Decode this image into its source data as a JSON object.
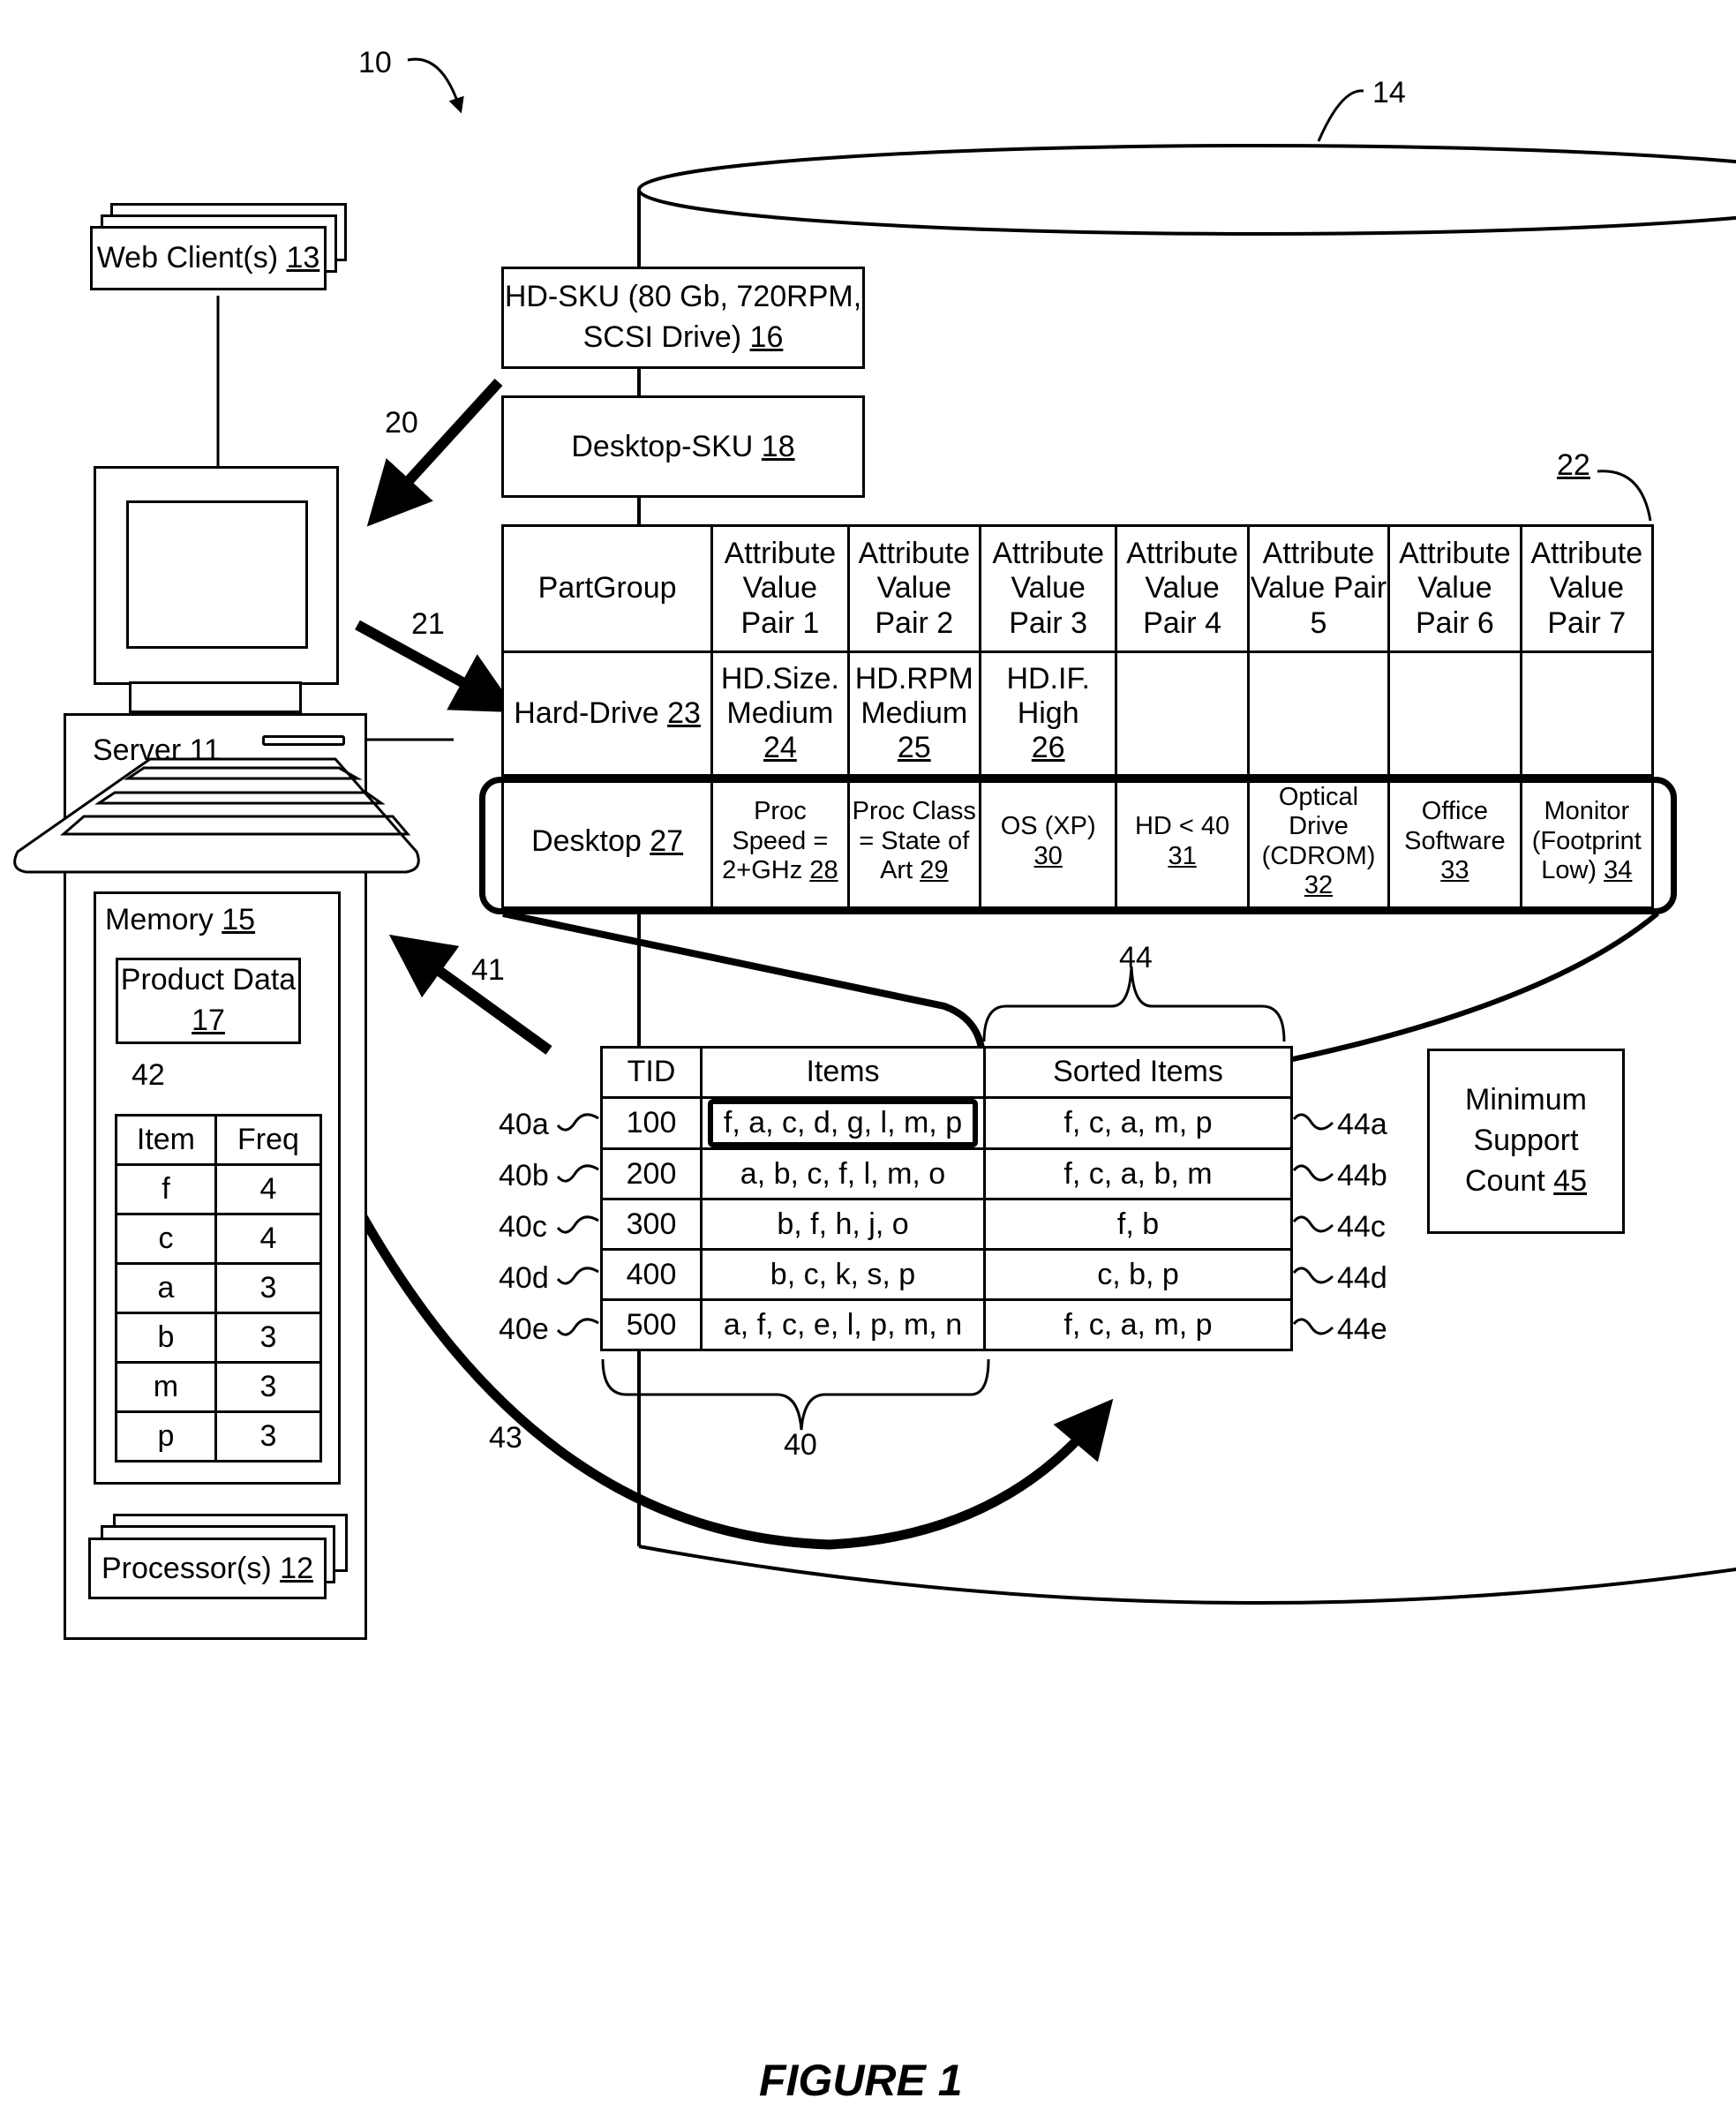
{
  "figure": {
    "caption": "FIGURE 1",
    "system_ref": "10",
    "database_ref": "14"
  },
  "web_clients": {
    "label": "Web Client(s)",
    "ref": "13"
  },
  "server": {
    "label": "Server",
    "ref": "11"
  },
  "memory": {
    "label": "Memory",
    "ref": "15"
  },
  "product_data": {
    "label": "Product Data",
    "ref": "17"
  },
  "processors": {
    "label": "Processor(s)",
    "ref": "12"
  },
  "hd_sku": {
    "line1": "HD-SKU (80 Gb, 720RPM,",
    "line2": "SCSI Drive)",
    "ref": "16"
  },
  "desktop_sku": {
    "label": "Desktop-SKU",
    "ref": "18"
  },
  "arrows": {
    "a20": "20",
    "a21": "21",
    "a41": "41",
    "a43": "43"
  },
  "attribute_table": {
    "ref": "22",
    "header": {
      "partgroup": "PartGroup",
      "pairs": [
        "Attribute Value Pair 1",
        "Attribute Value Pair 2",
        "Attribute Value Pair 3",
        "Attribute Value Pair 4",
        "Attribute Value Pair 5",
        "Attribute Value Pair 6",
        "Attribute Value Pair 7"
      ]
    },
    "rows": [
      {
        "group": "Hard-Drive",
        "group_ref": "23",
        "cells": [
          {
            "text": "HD.Size. Medium",
            "ref": "24"
          },
          {
            "text": "HD.RPM Medium",
            "ref": "25"
          },
          {
            "text": "HD.IF. High",
            "ref": "26"
          },
          {
            "text": "",
            "ref": ""
          },
          {
            "text": "",
            "ref": ""
          },
          {
            "text": "",
            "ref": ""
          },
          {
            "text": "",
            "ref": ""
          }
        ]
      },
      {
        "group": "Desktop",
        "group_ref": "27",
        "cells": [
          {
            "text": "Proc Speed = 2+GHz",
            "ref": "28"
          },
          {
            "text": "Proc Class = State of Art",
            "ref": "29"
          },
          {
            "text": "OS (XP)",
            "ref": "30"
          },
          {
            "text": "HD < 40",
            "ref": "31"
          },
          {
            "text": "Optical Drive (CDROM)",
            "ref": "32"
          },
          {
            "text": "Office Software",
            "ref": "33"
          },
          {
            "text": "Monitor (Footprint Low)",
            "ref": "34"
          }
        ]
      }
    ]
  },
  "transaction_table": {
    "ref": "40",
    "sorted_ref": "44",
    "headers": [
      "TID",
      "Items",
      "Sorted Items"
    ],
    "rows": [
      {
        "left_ref": "40a",
        "tid": "100",
        "items": "f, a, c, d, g, l, m, p",
        "sorted": "f, c, a, m, p",
        "right_ref": "44a"
      },
      {
        "left_ref": "40b",
        "tid": "200",
        "items": "a, b, c, f, l, m, o",
        "sorted": "f, c, a, b, m",
        "right_ref": "44b"
      },
      {
        "left_ref": "40c",
        "tid": "300",
        "items": "b, f, h, j, o",
        "sorted": "f, b",
        "right_ref": "44c"
      },
      {
        "left_ref": "40d",
        "tid": "400",
        "items": "b, c, k, s, p",
        "sorted": "c, b, p",
        "right_ref": "44d"
      },
      {
        "left_ref": "40e",
        "tid": "500",
        "items": "a, f, c, e, l, p, m, n",
        "sorted": "f, c, a, m, p",
        "right_ref": "44e"
      }
    ]
  },
  "frequency_table": {
    "ref": "42",
    "headers": [
      "Item",
      "Freq"
    ],
    "rows": [
      {
        "item": "f",
        "freq": "4"
      },
      {
        "item": "c",
        "freq": "4"
      },
      {
        "item": "a",
        "freq": "3"
      },
      {
        "item": "b",
        "freq": "3"
      },
      {
        "item": "m",
        "freq": "3"
      },
      {
        "item": "p",
        "freq": "3"
      }
    ]
  },
  "min_support": {
    "line1": "Minimum",
    "line2": "Support",
    "line3": "Count",
    "ref": "45"
  }
}
